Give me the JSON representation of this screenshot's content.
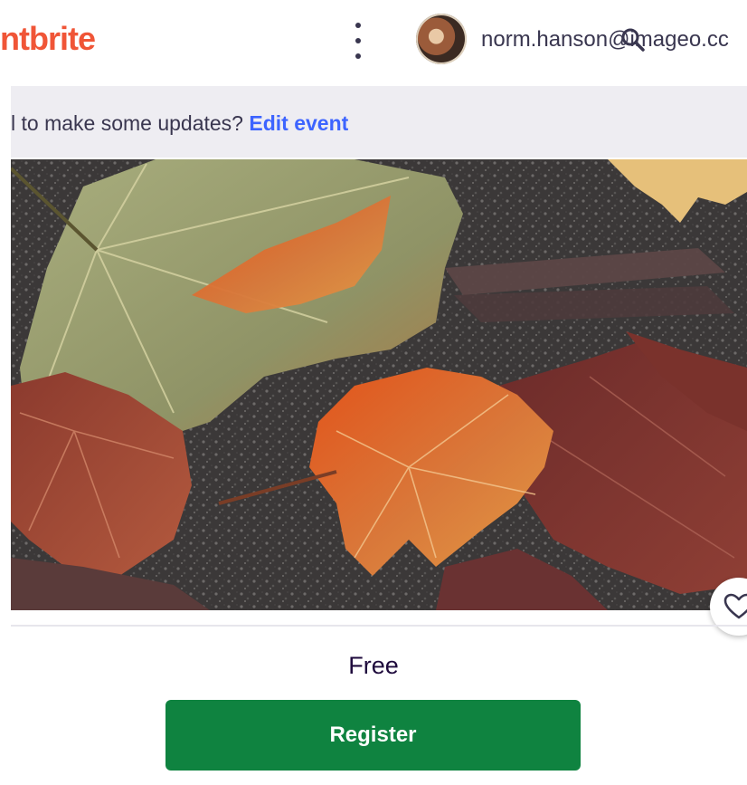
{
  "header": {
    "logo_text": "ntbrite",
    "user_email": "norm.hanson@imageo.cc"
  },
  "banner": {
    "text": "l to make some updates?",
    "link": "Edit event"
  },
  "event": {
    "price": "Free",
    "register_label": "Register"
  },
  "icons": {
    "menu": "kebab-menu-icon",
    "search": "search-icon",
    "favorite": "heart-icon"
  },
  "colors": {
    "brand": "#f05537",
    "link": "#3d64ff",
    "register": "#0f8340",
    "banner_bg": "#eeedf2"
  }
}
